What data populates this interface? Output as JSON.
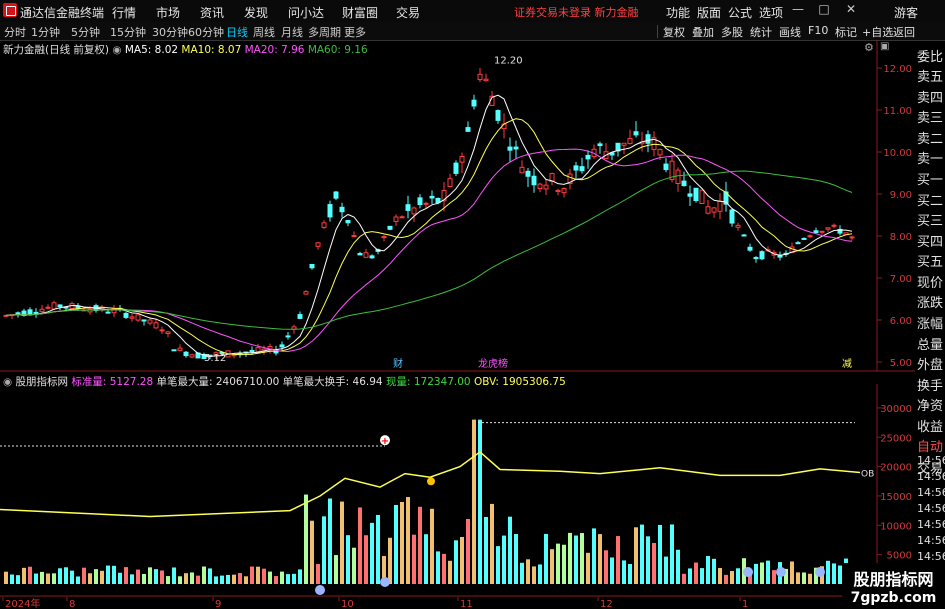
{
  "app": {
    "title": "通达信金融终端",
    "menus": [
      "行情",
      "市场",
      "资讯",
      "发现",
      "问小达",
      "财富圈",
      "交易"
    ],
    "login_status": "证券交易未登录  新力金融",
    "right_menus": [
      "功能",
      "版面",
      "公式",
      "选项"
    ],
    "guest": "游客"
  },
  "period_tabs": {
    "items": [
      "分时",
      "1分钟",
      "5分钟",
      "15分钟",
      "30分钟",
      "60分钟",
      "日线",
      "周线",
      "月线",
      "多周期",
      "更多"
    ],
    "active": "日线"
  },
  "toolbar": [
    "复权",
    "叠加",
    "多股",
    "统计",
    "画线",
    "F10",
    "标记",
    "+自选",
    "返回"
  ],
  "main_info": {
    "stock": "新力金融(日线 前复权)",
    "ma5": "MA5: 8.02",
    "ma10": "MA10: 8.07",
    "ma20": "MA20: 7.96",
    "ma60": "MA60: 9.16"
  },
  "price_axis": [
    "12.00",
    "11.00",
    "10.00",
    "9.00",
    "8.00",
    "7.00",
    "6.00",
    "5.00"
  ],
  "annotations": {
    "high": "12.20",
    "low": "5.12",
    "cai": "财",
    "bang": "龙虎榜",
    "jian": "减"
  },
  "sub_info": {
    "indicator": "股朋指标网",
    "std": "标准量: 5127.28",
    "max_vol": "单笔最大量: 2406710.00",
    "max_turn": "单笔最大换手: 46.94",
    "cur_vol": "现量: 172347.00",
    "obv": "OBV: 1905306.75"
  },
  "vol_axis": [
    "30000",
    "25000",
    "20000",
    "15000",
    "10000",
    "5000"
  ],
  "obv_label": "OB",
  "time_axis": [
    "2024年",
    "8",
    "9",
    "10",
    "11",
    "12",
    "1"
  ],
  "side_panel": [
    "委比",
    "卖五",
    "卖四",
    "卖三",
    "卖二",
    "卖一",
    "买一",
    "买二",
    "买三",
    "买四",
    "买五",
    "现价",
    "涨跌",
    "涨幅",
    "总量",
    "外盘",
    "换手",
    "净资",
    "收益",
    "自动",
    "交易"
  ],
  "side_times": [
    "14:56",
    "14:56",
    "14:56",
    "14:56",
    "14:56",
    "14:56",
    "14:56",
    "14:56",
    "14:56"
  ],
  "watermark": {
    "name": "股朋指标网",
    "url": "7gpzb.com"
  },
  "colors": {
    "up": "#ff3c3c",
    "down": "#54ffff",
    "ma5": "#ffffff",
    "ma10": "#ffff54",
    "ma20": "#ff54ff",
    "ma60": "#3cbe3c",
    "vol_up": "#f0c070",
    "vol_mid": "#b0ff9c",
    "obv": "#ffff54"
  }
}
